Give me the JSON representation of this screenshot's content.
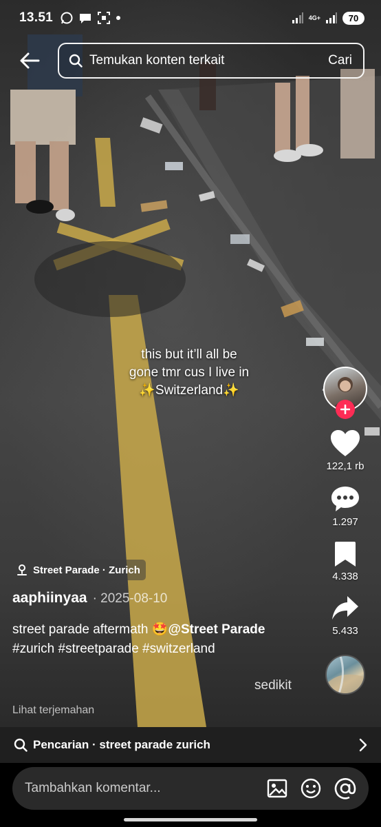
{
  "status_bar": {
    "time": "13.51",
    "network": "4G+",
    "battery": "70",
    "icons": [
      "whatsapp-icon",
      "chat-icon",
      "screenshot-icon",
      "dot-icon",
      "signal-icon",
      "signal-icon"
    ]
  },
  "search": {
    "placeholder": "Temukan konten terkait",
    "action_label": "Cari"
  },
  "video": {
    "caption_line1": "this but it’ll all be",
    "caption_line2": "gone tmr cus I live in",
    "caption_line3": "✨Switzerland✨"
  },
  "rail": {
    "likes": "122,1 rb",
    "comments": "1.297",
    "saves": "4.338",
    "shares": "5.433"
  },
  "post": {
    "location": "Street Parade · Zurich",
    "author": "aaphiinyaa",
    "date": "· 2025-08-10",
    "desc_text": "street parade aftermath 🤩",
    "mention": "@Street Parade",
    "hashtags": "#zurich #streetparade #switzerland",
    "more_label": "sedikit",
    "translate_label": "Lihat terjemahan"
  },
  "suggestion": {
    "label": "Pencarian · street parade zurich"
  },
  "comment": {
    "placeholder": "Tambahkan komentar..."
  },
  "colors": {
    "accent": "#fe2c55",
    "background": "#000000",
    "bar": "#1f1f1f",
    "input": "#2a2a2a",
    "road_line": "#c9a94a"
  }
}
